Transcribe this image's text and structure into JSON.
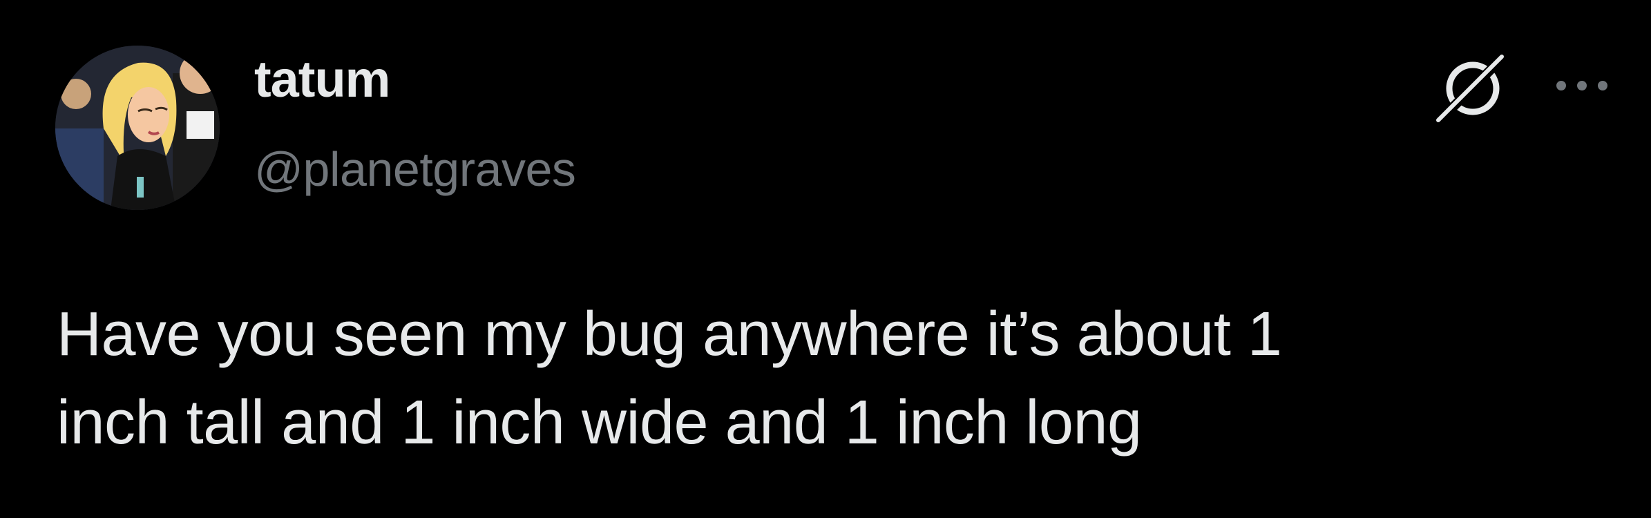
{
  "tweet": {
    "author": {
      "display_name": "tatum",
      "handle": "@planetgraves"
    },
    "text_lines": [
      "Have you seen my bug anywhere it’s about 1",
      "inch tall and 1 inch wide and 1 inch long"
    ],
    "icons": {
      "grok": "grok-icon",
      "more": "more-options-icon"
    }
  },
  "colors": {
    "background": "#000000",
    "primary_text": "#e7e9ea",
    "secondary_text": "#71767b"
  }
}
